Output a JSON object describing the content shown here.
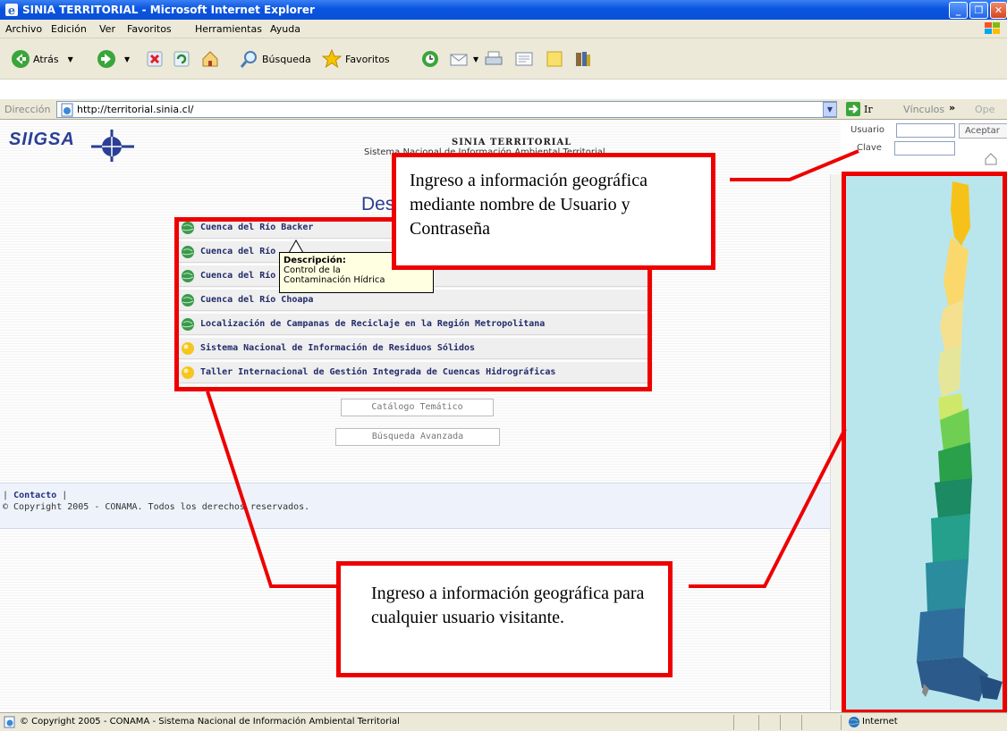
{
  "window": {
    "title": "SINIA TERRITORIAL - Microsoft Internet Explorer"
  },
  "menu": [
    "Archivo",
    "Edición",
    "Ver",
    "Favoritos",
    "Herramientas",
    "Ayuda"
  ],
  "toolbar": {
    "back": "Atrás",
    "search": "Búsqueda",
    "favorites": "Favoritos"
  },
  "address": {
    "label": "Dirección",
    "url": "http://territorial.sinia.cl/",
    "go": "Ir",
    "links": "Vínculos",
    "more": "Ope"
  },
  "page": {
    "logo": "SIIGSA",
    "title": "SINIA TERRITORIAL",
    "subtitle": "Sistema Nacional de Información Ambiental Territorial",
    "heading": "Des",
    "login": {
      "user_label": "Usuario",
      "password_label": "Clave",
      "accept": "Aceptar"
    },
    "items": [
      {
        "label": "Cuenca del Río Backer",
        "icon": "globe-icon"
      },
      {
        "label": "Cuenca del Río",
        "icon": "globe-icon"
      },
      {
        "label": "Cuenca del Río",
        "icon": "globe-icon"
      },
      {
        "label": "Cuenca del Río Choapa",
        "icon": "globe-icon"
      },
      {
        "label": "Localización de Campanas de Reciclaje en la Región Metropolitana",
        "icon": "globe-icon"
      },
      {
        "label": "Sistema Nacional de Información de Residuos Sólidos",
        "icon": "bulb-icon"
      },
      {
        "label": "Taller Internacional de Gestión Integrada de Cuencas Hidrográficas",
        "icon": "bulb-icon"
      }
    ],
    "tooltip": {
      "title": "Descripción:",
      "line1": "Control de la",
      "line2": "Contaminación Hídrica"
    },
    "buttons": {
      "catalog": "Catálogo Temático",
      "advanced": "Búsqueda Avanzada"
    },
    "footer": {
      "pipe_open": "|",
      "contact": "Contacto",
      "pipe_close": "|",
      "copyright": "© Copyright 2005 - CONAMA. Todos los derechos reservados."
    }
  },
  "annotations": {
    "top": "Ingreso a información geográfica mediante nombre de Usuario y Contraseña",
    "bottom": "Ingreso a información geográfica para cualquier usuario visitante."
  },
  "status": {
    "text": "© Copyright 2005 - CONAMA - Sistema Nacional de Información Ambiental Territorial",
    "zone": "Internet"
  },
  "colors": {
    "titlebar": "#0a54e0",
    "annotation": "#ee0000",
    "link": "#222b6a",
    "heading": "#2b3d8f"
  }
}
